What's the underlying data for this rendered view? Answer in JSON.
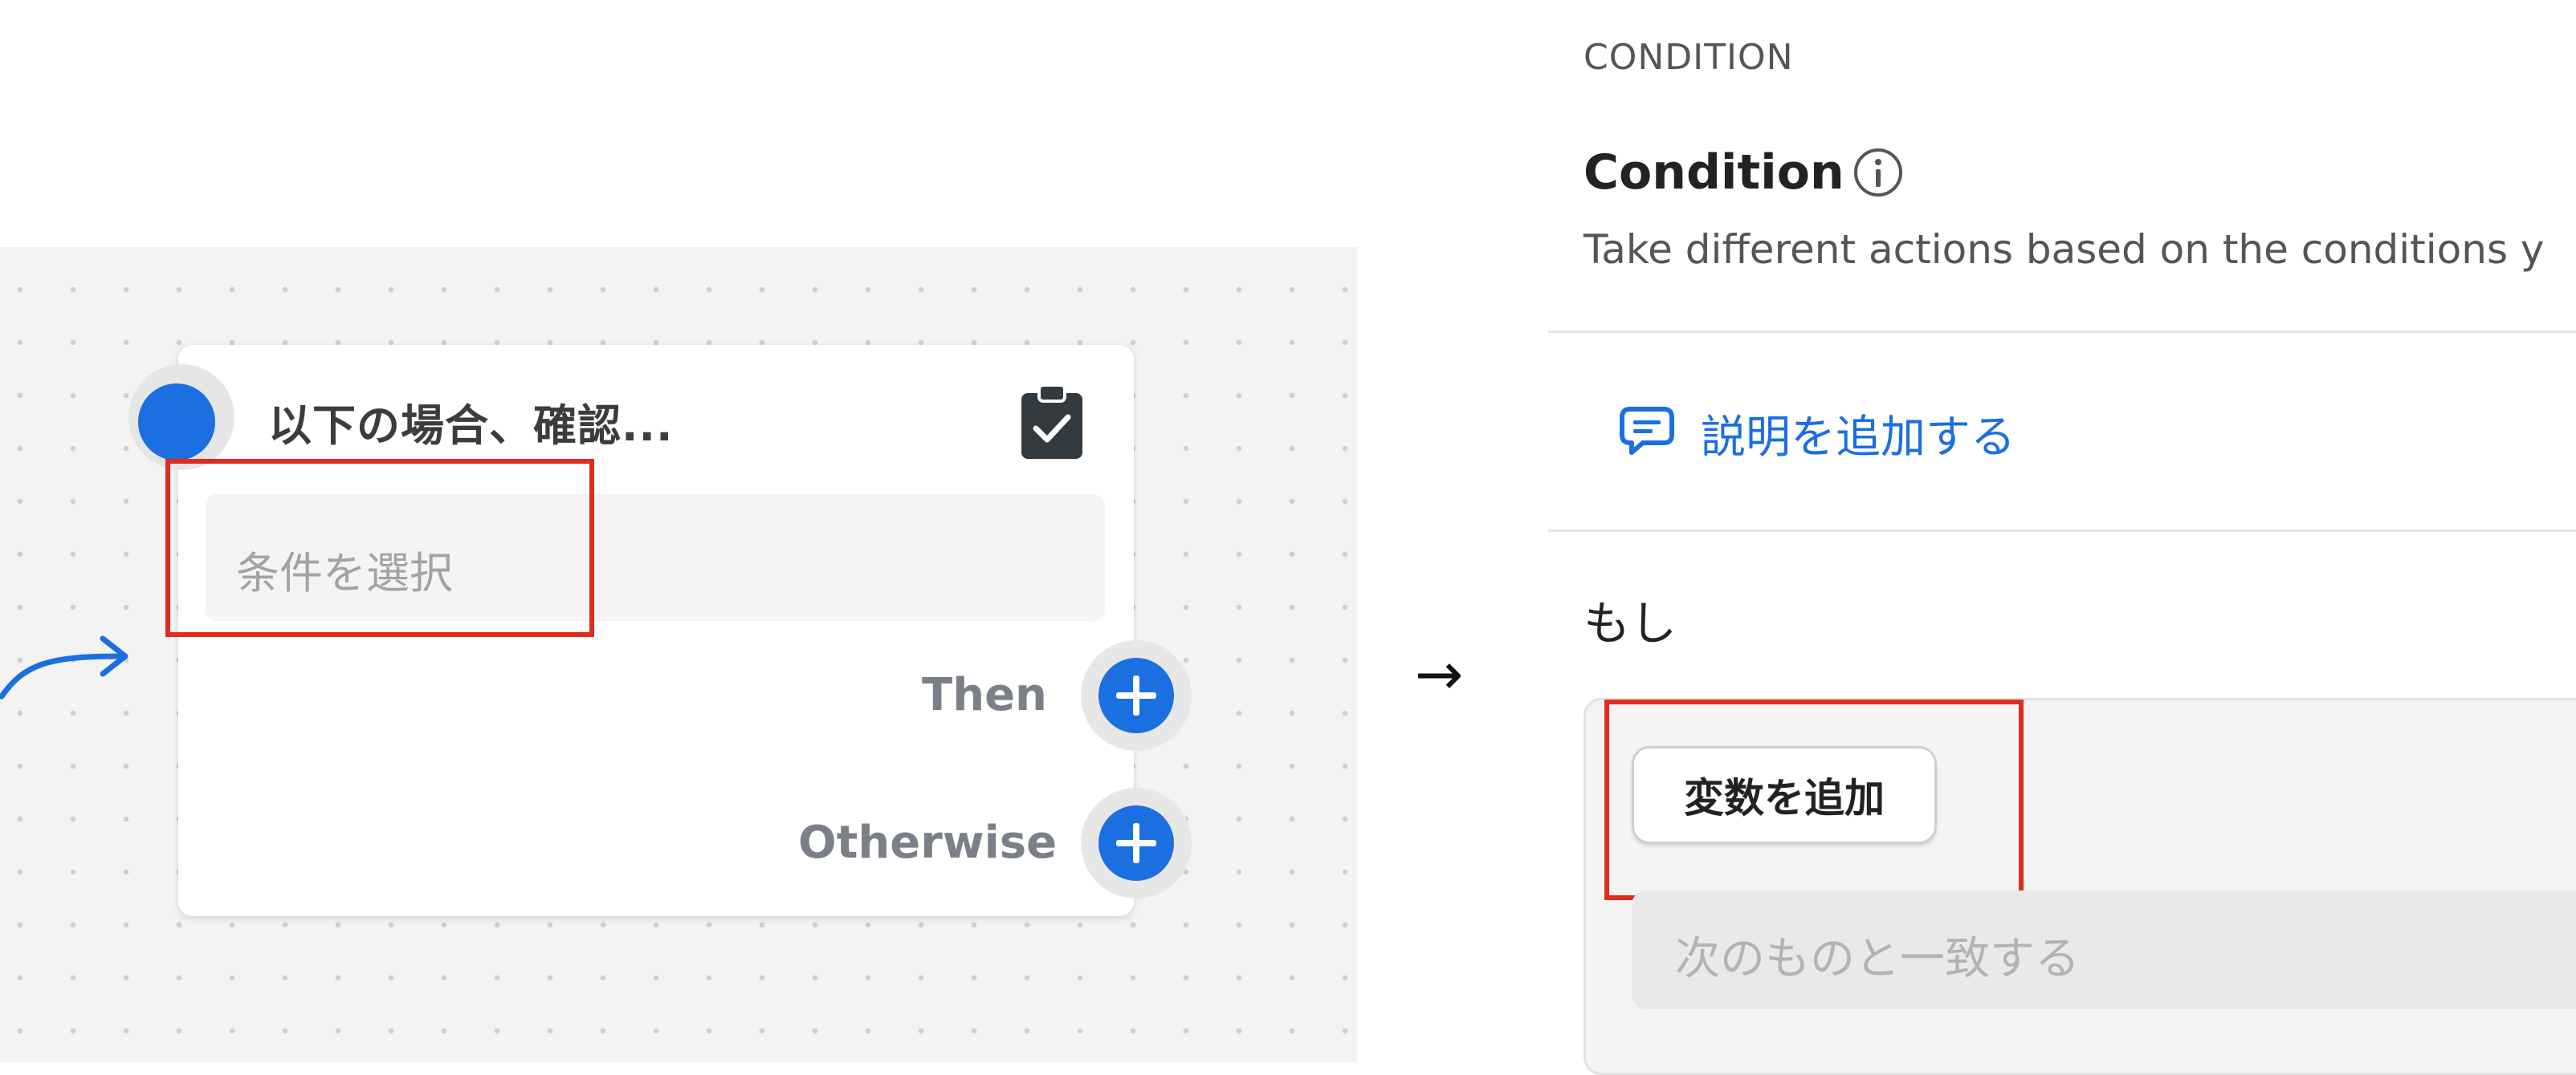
{
  "canvas": {
    "node": {
      "title": "以下の場合、確認...",
      "condition_placeholder": "条件を選択",
      "branches": {
        "then_label": "Then",
        "otherwise_label": "Otherwise"
      }
    }
  },
  "transition_arrow": "→",
  "panel": {
    "section_label": "CONDITION",
    "title": "Condition",
    "description": "Take different actions based on the conditions y",
    "add_description_link": "説明を追加する",
    "if_label": "もし",
    "add_variable_button": "変数を追加",
    "match_placeholder": "次のものと一致する"
  },
  "colors": {
    "accent_blue": "#1b6fe0",
    "highlight_red": "#e02c1c",
    "canvas_bg": "#f3f3f3"
  },
  "icons": {
    "node_icon": "clipboard-check-icon",
    "title_info": "info-icon",
    "description_link": "comment-icon",
    "branch_buttons": "plus-icon"
  }
}
